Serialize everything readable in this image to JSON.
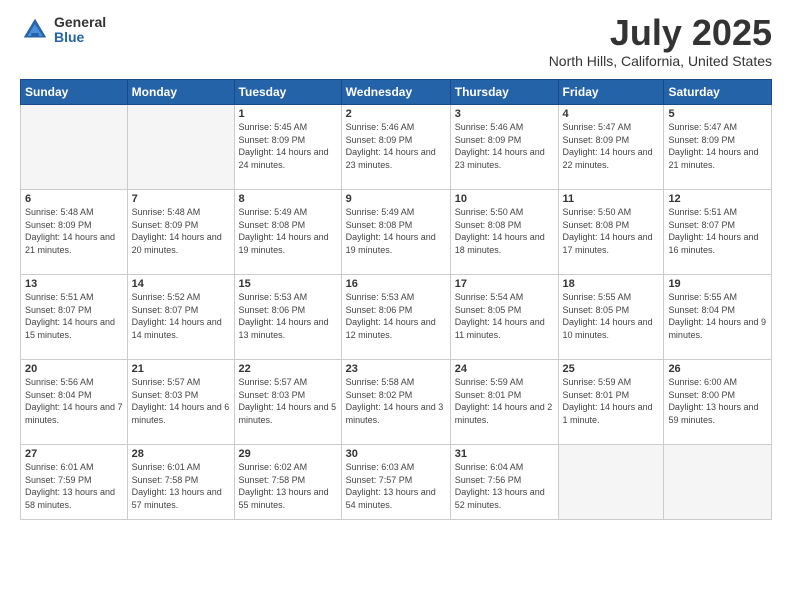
{
  "logo": {
    "general": "General",
    "blue": "Blue"
  },
  "header": {
    "month": "July 2025",
    "location": "North Hills, California, United States"
  },
  "weekdays": [
    "Sunday",
    "Monday",
    "Tuesday",
    "Wednesday",
    "Thursday",
    "Friday",
    "Saturday"
  ],
  "weeks": [
    [
      {
        "day": "",
        "sunrise": "",
        "sunset": "",
        "daylight": "",
        "empty": true
      },
      {
        "day": "",
        "sunrise": "",
        "sunset": "",
        "daylight": "",
        "empty": true
      },
      {
        "day": "1",
        "sunrise": "Sunrise: 5:45 AM",
        "sunset": "Sunset: 8:09 PM",
        "daylight": "Daylight: 14 hours and 24 minutes."
      },
      {
        "day": "2",
        "sunrise": "Sunrise: 5:46 AM",
        "sunset": "Sunset: 8:09 PM",
        "daylight": "Daylight: 14 hours and 23 minutes."
      },
      {
        "day": "3",
        "sunrise": "Sunrise: 5:46 AM",
        "sunset": "Sunset: 8:09 PM",
        "daylight": "Daylight: 14 hours and 23 minutes."
      },
      {
        "day": "4",
        "sunrise": "Sunrise: 5:47 AM",
        "sunset": "Sunset: 8:09 PM",
        "daylight": "Daylight: 14 hours and 22 minutes."
      },
      {
        "day": "5",
        "sunrise": "Sunrise: 5:47 AM",
        "sunset": "Sunset: 8:09 PM",
        "daylight": "Daylight: 14 hours and 21 minutes."
      }
    ],
    [
      {
        "day": "6",
        "sunrise": "Sunrise: 5:48 AM",
        "sunset": "Sunset: 8:09 PM",
        "daylight": "Daylight: 14 hours and 21 minutes."
      },
      {
        "day": "7",
        "sunrise": "Sunrise: 5:48 AM",
        "sunset": "Sunset: 8:09 PM",
        "daylight": "Daylight: 14 hours and 20 minutes."
      },
      {
        "day": "8",
        "sunrise": "Sunrise: 5:49 AM",
        "sunset": "Sunset: 8:08 PM",
        "daylight": "Daylight: 14 hours and 19 minutes."
      },
      {
        "day": "9",
        "sunrise": "Sunrise: 5:49 AM",
        "sunset": "Sunset: 8:08 PM",
        "daylight": "Daylight: 14 hours and 19 minutes."
      },
      {
        "day": "10",
        "sunrise": "Sunrise: 5:50 AM",
        "sunset": "Sunset: 8:08 PM",
        "daylight": "Daylight: 14 hours and 18 minutes."
      },
      {
        "day": "11",
        "sunrise": "Sunrise: 5:50 AM",
        "sunset": "Sunset: 8:08 PM",
        "daylight": "Daylight: 14 hours and 17 minutes."
      },
      {
        "day": "12",
        "sunrise": "Sunrise: 5:51 AM",
        "sunset": "Sunset: 8:07 PM",
        "daylight": "Daylight: 14 hours and 16 minutes."
      }
    ],
    [
      {
        "day": "13",
        "sunrise": "Sunrise: 5:51 AM",
        "sunset": "Sunset: 8:07 PM",
        "daylight": "Daylight: 14 hours and 15 minutes."
      },
      {
        "day": "14",
        "sunrise": "Sunrise: 5:52 AM",
        "sunset": "Sunset: 8:07 PM",
        "daylight": "Daylight: 14 hours and 14 minutes."
      },
      {
        "day": "15",
        "sunrise": "Sunrise: 5:53 AM",
        "sunset": "Sunset: 8:06 PM",
        "daylight": "Daylight: 14 hours and 13 minutes."
      },
      {
        "day": "16",
        "sunrise": "Sunrise: 5:53 AM",
        "sunset": "Sunset: 8:06 PM",
        "daylight": "Daylight: 14 hours and 12 minutes."
      },
      {
        "day": "17",
        "sunrise": "Sunrise: 5:54 AM",
        "sunset": "Sunset: 8:05 PM",
        "daylight": "Daylight: 14 hours and 11 minutes."
      },
      {
        "day": "18",
        "sunrise": "Sunrise: 5:55 AM",
        "sunset": "Sunset: 8:05 PM",
        "daylight": "Daylight: 14 hours and 10 minutes."
      },
      {
        "day": "19",
        "sunrise": "Sunrise: 5:55 AM",
        "sunset": "Sunset: 8:04 PM",
        "daylight": "Daylight: 14 hours and 9 minutes."
      }
    ],
    [
      {
        "day": "20",
        "sunrise": "Sunrise: 5:56 AM",
        "sunset": "Sunset: 8:04 PM",
        "daylight": "Daylight: 14 hours and 7 minutes."
      },
      {
        "day": "21",
        "sunrise": "Sunrise: 5:57 AM",
        "sunset": "Sunset: 8:03 PM",
        "daylight": "Daylight: 14 hours and 6 minutes."
      },
      {
        "day": "22",
        "sunrise": "Sunrise: 5:57 AM",
        "sunset": "Sunset: 8:03 PM",
        "daylight": "Daylight: 14 hours and 5 minutes."
      },
      {
        "day": "23",
        "sunrise": "Sunrise: 5:58 AM",
        "sunset": "Sunset: 8:02 PM",
        "daylight": "Daylight: 14 hours and 3 minutes."
      },
      {
        "day": "24",
        "sunrise": "Sunrise: 5:59 AM",
        "sunset": "Sunset: 8:01 PM",
        "daylight": "Daylight: 14 hours and 2 minutes."
      },
      {
        "day": "25",
        "sunrise": "Sunrise: 5:59 AM",
        "sunset": "Sunset: 8:01 PM",
        "daylight": "Daylight: 14 hours and 1 minute."
      },
      {
        "day": "26",
        "sunrise": "Sunrise: 6:00 AM",
        "sunset": "Sunset: 8:00 PM",
        "daylight": "Daylight: 13 hours and 59 minutes."
      }
    ],
    [
      {
        "day": "27",
        "sunrise": "Sunrise: 6:01 AM",
        "sunset": "Sunset: 7:59 PM",
        "daylight": "Daylight: 13 hours and 58 minutes."
      },
      {
        "day": "28",
        "sunrise": "Sunrise: 6:01 AM",
        "sunset": "Sunset: 7:58 PM",
        "daylight": "Daylight: 13 hours and 57 minutes."
      },
      {
        "day": "29",
        "sunrise": "Sunrise: 6:02 AM",
        "sunset": "Sunset: 7:58 PM",
        "daylight": "Daylight: 13 hours and 55 minutes."
      },
      {
        "day": "30",
        "sunrise": "Sunrise: 6:03 AM",
        "sunset": "Sunset: 7:57 PM",
        "daylight": "Daylight: 13 hours and 54 minutes."
      },
      {
        "day": "31",
        "sunrise": "Sunrise: 6:04 AM",
        "sunset": "Sunset: 7:56 PM",
        "daylight": "Daylight: 13 hours and 52 minutes."
      },
      {
        "day": "",
        "sunrise": "",
        "sunset": "",
        "daylight": "",
        "empty": true
      },
      {
        "day": "",
        "sunrise": "",
        "sunset": "",
        "daylight": "",
        "empty": true
      }
    ]
  ]
}
